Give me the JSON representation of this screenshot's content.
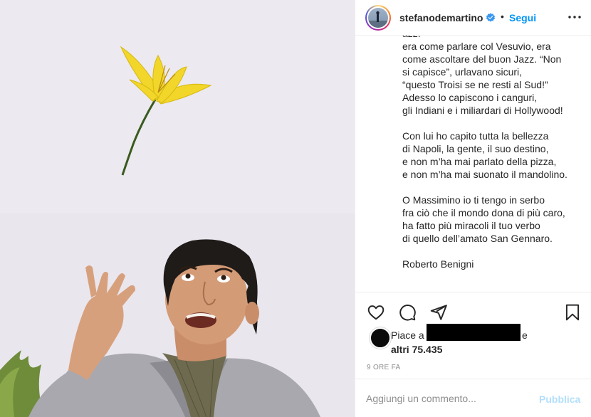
{
  "photo": {
    "alt": "Photo"
  },
  "header": {
    "username": "stefanodemartino",
    "separator": "•",
    "follow_label": "Segui"
  },
  "caption": {
    "paragraphs": [
      "azz!”\nera come parlare col Vesuvio, era\ncome ascoltare del buon Jazz. “Non\nsi capisce”, urlavano sicuri,\n“questo Troisi se ne resti al Sud!”\nAdesso lo capiscono i canguri,\ngli Indiani e i miliardari di Hollywood!",
      "Con lui ho capito tutta la bellezza\ndi Napoli, la gente, il suo destino,\ne non m’ha mai parlato della pizza,\ne non m’ha mai suonato il mandolino.",
      "O Massimino io ti tengo in serbo\nfra ciò che il mondo dona di più caro,\nha fatto più miracoli il tuo verbo\ndi quello dell’amato San Gennaro.",
      "Roberto Benigni"
    ]
  },
  "actions": {
    "like_icon": "heart-icon",
    "comment_icon": "comment-icon",
    "share_icon": "paper-plane-icon",
    "save_icon": "bookmark-icon"
  },
  "likes": {
    "prefix": "Piace a",
    "conjunction": "e",
    "others": "altri 75.435"
  },
  "timestamp": "9 ore fa",
  "comment": {
    "placeholder": "Aggiungi un commento...",
    "publish_label": "Pubblica"
  },
  "colors": {
    "accent": "#0095f6",
    "publish_disabled": "#b2dffc",
    "verified": "#3897f0",
    "muted": "#8e8e8e"
  }
}
